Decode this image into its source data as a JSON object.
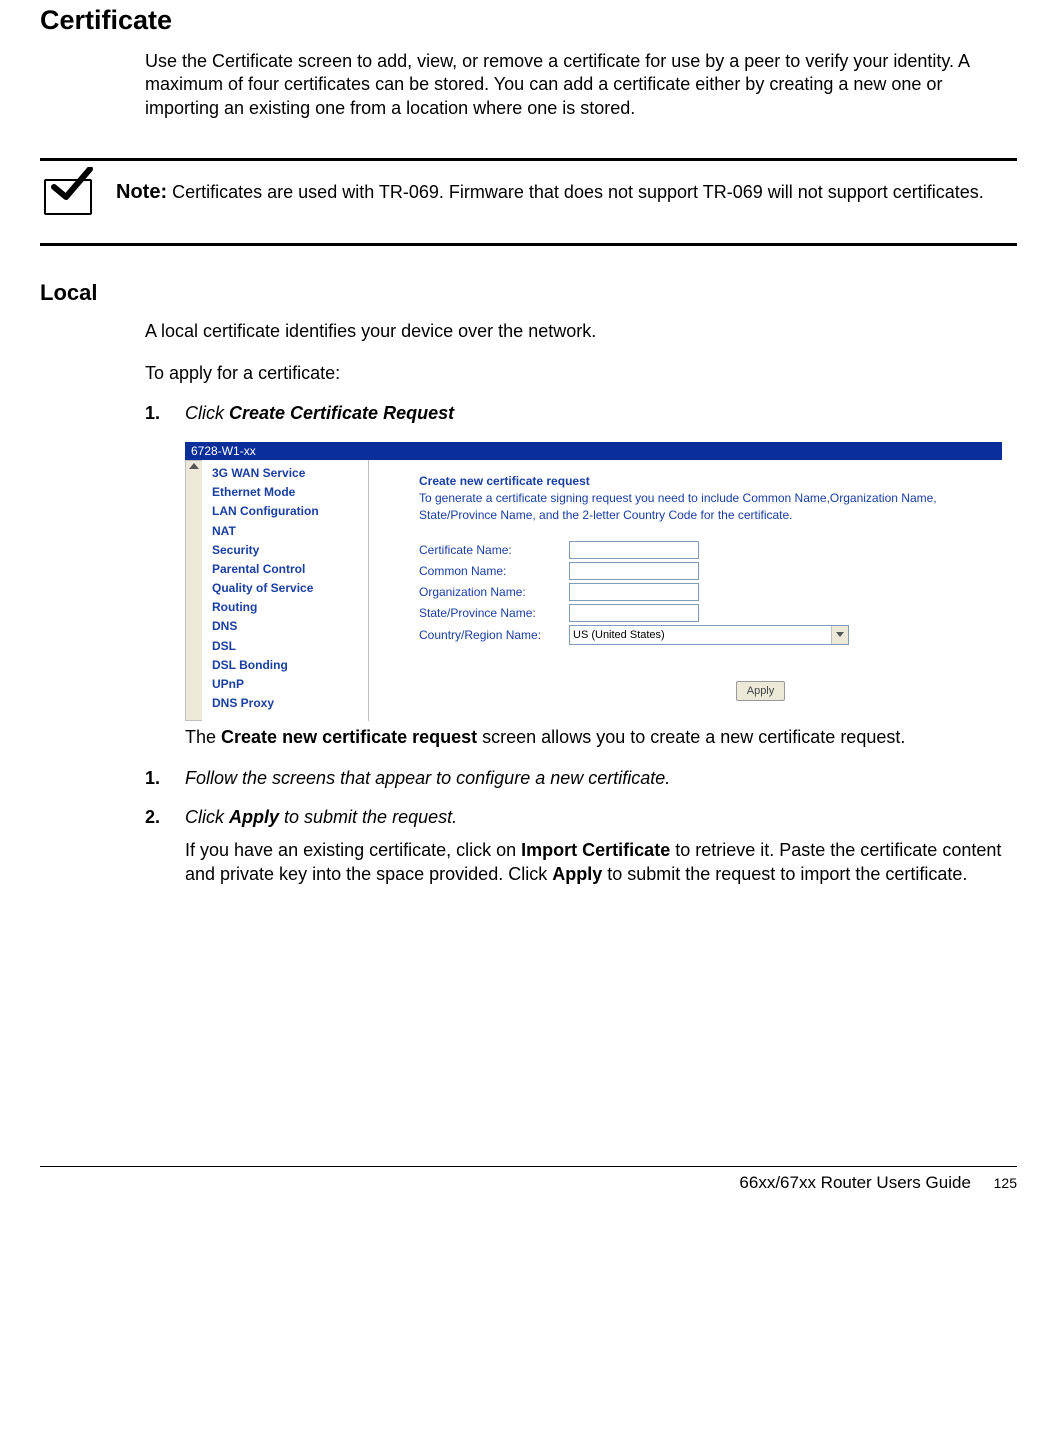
{
  "heading_main": "Certificate",
  "intro_para": "Use the Certificate screen to add, view, or remove a certificate for use by a peer to verify your identity. A maximum of four certificates can be stored. You can add a certificate either by creating a new one or importing an existing one from a location where one is stored.",
  "note": {
    "label": "Note:",
    "text": "Certificates are used with TR-069. Firmware that does not support TR-069 will not support certificates."
  },
  "heading_local": "Local",
  "local_para": "A local certificate identifies your device over the network.",
  "apply_intro": "To apply for a certificate:",
  "steps_a": {
    "s1_num": "1.",
    "s1_text_prefix": "Click ",
    "s1_text_bold": "Create Certificate Request"
  },
  "screenshot": {
    "titlebar": "6728-W1-xx",
    "sidebar_items": [
      "3G WAN Service",
      "Ethernet Mode",
      "LAN Configuration",
      "NAT",
      "Security",
      "Parental Control",
      "Quality of Service",
      "Routing",
      "DNS",
      "DSL",
      "DSL Bonding",
      "UPnP",
      "DNS Proxy"
    ],
    "main_title": "Create new certificate request",
    "main_desc": "To generate a certificate signing request you need to include Common Name,Organization Name, State/Province Name, and the 2-letter Country Code for the certificate.",
    "labels": {
      "cert_name": "Certificate Name:",
      "common_name": "Common Name:",
      "org_name": "Organization Name:",
      "state_name": "State/Province Name:",
      "country_name": "Country/Region Name:"
    },
    "country_value": "US (United States)",
    "apply_btn": "Apply"
  },
  "caption_prefix": "The ",
  "caption_bold": "Create new certificate request",
  "caption_suffix": " screen allows you to create a new certificate request.",
  "steps_b": {
    "s1_num": "1.",
    "s1_text": "Follow the screens that appear to configure a new certificate.",
    "s2_num": "2.",
    "s2_text_prefix": "Click ",
    "s2_text_bold": "Apply",
    "s2_text_suffix": " to submit the request."
  },
  "import_para_1": "If you have an existing certificate, click on ",
  "import_bold_1": "Import Certificate",
  "import_para_2": " to retrieve it. Paste the certificate content and private key into the space provided. Click ",
  "import_bold_2": "Apply",
  "import_para_3": " to submit the request to import the certificate.",
  "footer_title": "66xx/67xx Router Users Guide",
  "footer_page": "125"
}
